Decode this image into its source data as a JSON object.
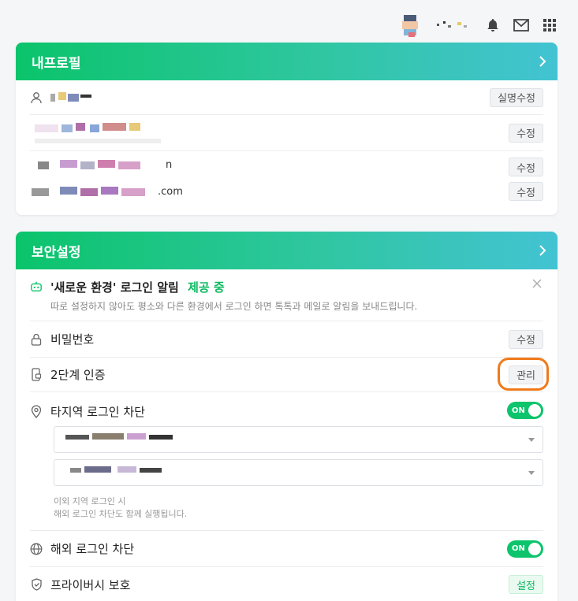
{
  "topbar": {
    "icons": [
      "bell-icon",
      "mail-icon",
      "apps-grid-icon"
    ]
  },
  "profile": {
    "title": "내프로필",
    "rows": [
      {
        "action": "실명수정",
        "value_suffix": ""
      },
      {
        "action": "수정",
        "value_suffix": ""
      },
      {
        "action": "수정",
        "value_suffix": "n"
      },
      {
        "action": "수정",
        "value_suffix": ".com"
      }
    ]
  },
  "security": {
    "title": "보안설정",
    "new_env": {
      "label": "'새로운 환경' 로그인 알림",
      "status": "제공 중",
      "description": "따로 설정하지 않아도 평소와 다른 환경에서 로그인 하면 톡톡과 메일로 알림을 보내드립니다."
    },
    "password": {
      "label": "비밀번호",
      "action": "수정"
    },
    "two_factor": {
      "label": "2단계 인증",
      "action": "관리"
    },
    "region_block": {
      "label": "타지역 로그인 차단",
      "toggle": "ON",
      "note_line1": "이외 지역 로그인 시",
      "note_line2": "해외 로그인 차단도 함께 실행됩니다."
    },
    "overseas_block": {
      "label": "해외 로그인 차단",
      "toggle": "ON"
    },
    "privacy": {
      "label": "프라이버시 보호",
      "action": "설정"
    }
  },
  "colors": {
    "brand_green": "#0bc46b",
    "header_gradient_end": "#43c3d3",
    "annotation_orange": "#f07a1a"
  }
}
